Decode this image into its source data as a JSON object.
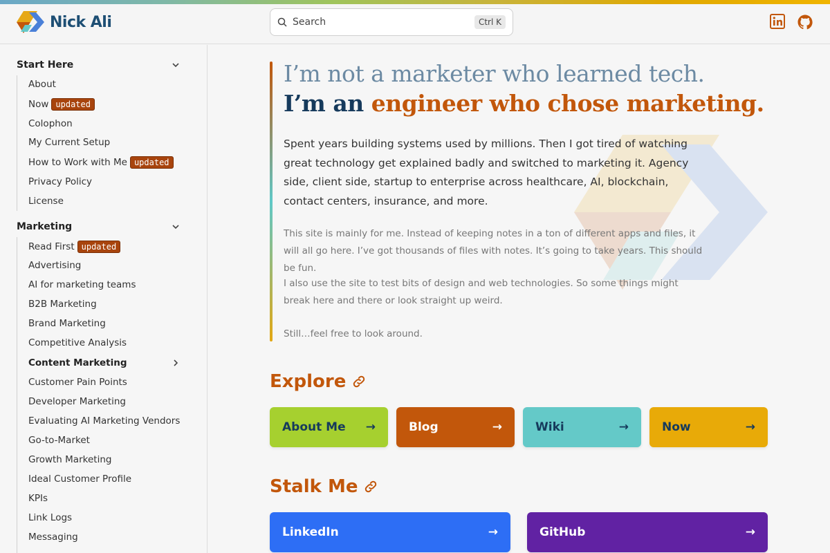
{
  "header": {
    "brand": "Nick Ali",
    "search_placeholder": "Search",
    "search_shortcut": "Ctrl K",
    "social": [
      "linkedin-icon",
      "github-icon"
    ]
  },
  "sidebar": {
    "sections": [
      {
        "title": "Start Here",
        "items": [
          {
            "label": "About"
          },
          {
            "label": "Now",
            "badge": "updated"
          },
          {
            "label": "Colophon"
          },
          {
            "label": "My Current Setup"
          },
          {
            "label": "How to Work with Me",
            "badge": "updated"
          },
          {
            "label": "Privacy Policy"
          },
          {
            "label": "License"
          }
        ]
      },
      {
        "title": "Marketing",
        "items": [
          {
            "label": "Read First",
            "badge": "updated"
          },
          {
            "label": "Advertising"
          },
          {
            "label": "AI for marketing teams"
          },
          {
            "label": "B2B Marketing"
          },
          {
            "label": "Brand Marketing"
          },
          {
            "label": "Competitive Analysis"
          },
          {
            "label": "Content Marketing"
          },
          {
            "label": "Customer Pain Points"
          },
          {
            "label": "Developer Marketing"
          },
          {
            "label": "Evaluating AI Marketing Vendors"
          },
          {
            "label": "Go-to-Market"
          },
          {
            "label": "Growth Marketing"
          },
          {
            "label": "Ideal Customer Profile"
          },
          {
            "label": "KPIs"
          },
          {
            "label": "Link Logs"
          },
          {
            "label": "Messaging"
          }
        ]
      }
    ]
  },
  "main": {
    "headline_line1": "I’m not a marketer who learned tech.",
    "headline_line2_prefix": "I’m an ",
    "headline_line2_accent": "engineer who chose marketing.",
    "lead": "Spent years building systems used by millions. Then I got tired of watching great technology get explained badly and switched to marketing it. Agency side, client side, startup to enterprise across healthcare, AI, blockchain, contact centers, insurance, and more.",
    "para1": "This site is mainly for me. Instead of keeping notes in a ton of different apps and files, it will all go here. I’ve got thousands of files with notes. It’s going to take years. This should be fun.",
    "para2": "I also use the site to test bits of design and web technologies. So some things might break here and there or look straight up weird.",
    "para3": "Still…feel free to look around.",
    "explore_title": "Explore",
    "explore_cards": [
      {
        "label": "About Me",
        "color": "#a6d02f",
        "text": "#163a5c"
      },
      {
        "label": "Blog",
        "color": "#c2570b",
        "text": "#ffffff"
      },
      {
        "label": "Wiki",
        "color": "#64c9c8",
        "text": "#163a5c"
      },
      {
        "label": "Now",
        "color": "#e8aa08",
        "text": "#163a5c"
      }
    ],
    "stalk_title": "Stalk Me",
    "stalk_cards": [
      {
        "label": "LinkedIn",
        "color": "#2d6ef5",
        "text": "#ffffff"
      },
      {
        "label": "GitHub",
        "color": "#6122a3",
        "text": "#ffffff"
      }
    ]
  }
}
